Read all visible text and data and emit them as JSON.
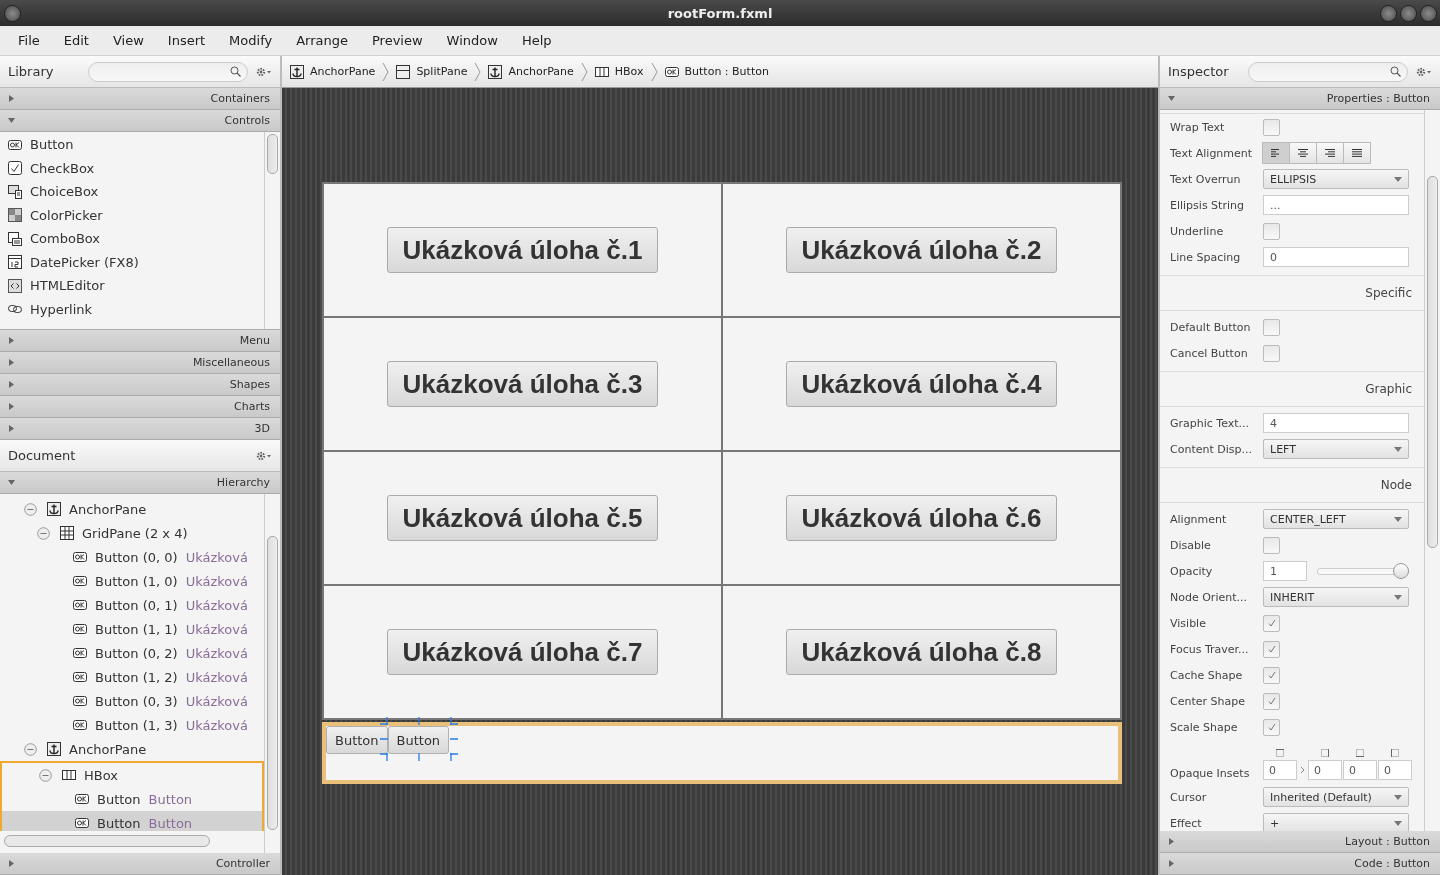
{
  "window": {
    "title": "rootForm.fxml"
  },
  "menu": [
    "File",
    "Edit",
    "View",
    "Insert",
    "Modify",
    "Arrange",
    "Preview",
    "Window",
    "Help"
  ],
  "library": {
    "title": "Library",
    "sections_before": [
      {
        "label": "Containers",
        "expanded": false
      },
      {
        "label": "Controls",
        "expanded": true
      }
    ],
    "items": [
      {
        "label": "Button",
        "kind": "ok"
      },
      {
        "label": "CheckBox",
        "kind": "check"
      },
      {
        "label": "ChoiceBox",
        "kind": "choice"
      },
      {
        "label": "ColorPicker",
        "kind": "color"
      },
      {
        "label": "ComboBox",
        "kind": "combo"
      },
      {
        "label": "DatePicker  (FX8)",
        "kind": "date"
      },
      {
        "label": "HTMLEditor",
        "kind": "html"
      },
      {
        "label": "Hyperlink",
        "kind": "link"
      }
    ],
    "sections_after": [
      {
        "label": "Menu",
        "expanded": false
      },
      {
        "label": "Miscellaneous",
        "expanded": false
      },
      {
        "label": "Shapes",
        "expanded": false
      },
      {
        "label": "Charts",
        "expanded": false
      },
      {
        "label": "3D",
        "expanded": false
      }
    ]
  },
  "document": {
    "title": "Document",
    "section": {
      "label": "Hierarchy",
      "expanded": true
    },
    "tree": [
      {
        "label": "AnchorPane",
        "kind": "anchor",
        "expanded": true,
        "selected": false,
        "children": [
          {
            "label": "GridPane (2 x 4)",
            "kind": "grid",
            "expanded": true,
            "selected": false,
            "children": [
              {
                "label": "Button (0, 0)",
                "info": "Ukázková",
                "kind": "ok",
                "selected": false
              },
              {
                "label": "Button (1, 0)",
                "info": "Ukázková",
                "kind": "ok",
                "selected": false
              },
              {
                "label": "Button (0, 1)",
                "info": "Ukázková",
                "kind": "ok",
                "selected": false
              },
              {
                "label": "Button (1, 1)",
                "info": "Ukázková",
                "kind": "ok",
                "selected": false
              },
              {
                "label": "Button (0, 2)",
                "info": "Ukázková",
                "kind": "ok",
                "selected": false
              },
              {
                "label": "Button (1, 2)",
                "info": "Ukázková",
                "kind": "ok",
                "selected": false
              },
              {
                "label": "Button (0, 3)",
                "info": "Ukázková",
                "kind": "ok",
                "selected": false
              },
              {
                "label": "Button (1, 3)",
                "info": "Ukázková",
                "kind": "ok",
                "selected": false
              }
            ]
          }
        ]
      },
      {
        "label": "AnchorPane",
        "kind": "anchor",
        "expanded": true,
        "selected": false,
        "children": [
          {
            "label": "HBox",
            "kind": "hbox",
            "expanded": true,
            "selected": false,
            "outlined": true,
            "children": [
              {
                "label": "Button",
                "info": "Button",
                "kind": "ok",
                "selected": false
              },
              {
                "label": "Button",
                "info": "Button",
                "kind": "ok",
                "selected": true
              }
            ]
          }
        ]
      }
    ],
    "footer": {
      "label": "Controller",
      "expanded": false
    }
  },
  "breadcrumb": [
    {
      "label": "AnchorPane",
      "kind": "anchor"
    },
    {
      "label": "SplitPane",
      "kind": "split"
    },
    {
      "label": "AnchorPane",
      "kind": "anchor"
    },
    {
      "label": "HBox",
      "kind": "hbox"
    },
    {
      "label": "Button : Button",
      "kind": "ok"
    }
  ],
  "canvas": {
    "grid_buttons": [
      "Ukázková úloha č.1",
      "Ukázková úloha č.2",
      "Ukázková úloha č.3",
      "Ukázková úloha č.4",
      "Ukázková úloha č.5",
      "Ukázková úloha č.6",
      "Ukázková úloha č.7",
      "Ukázková úloha č.8"
    ],
    "hbox_buttons": [
      {
        "label": "Button",
        "selected": false
      },
      {
        "label": "Button",
        "selected": true
      }
    ]
  },
  "inspector": {
    "title": "Inspector",
    "header": {
      "label": "Properties : Button",
      "expanded": true
    },
    "rows": [
      {
        "kind": "checkbox",
        "label": "Wrap Text",
        "checked": false
      },
      {
        "kind": "alignment",
        "label": "Text Alignment",
        "options": [
          {
            "kind": "left",
            "selected": true
          },
          {
            "kind": "center",
            "selected": false
          },
          {
            "kind": "right",
            "selected": false
          },
          {
            "kind": "justify",
            "selected": false
          }
        ]
      },
      {
        "kind": "dropdown",
        "label": "Text Overrun",
        "value": "ELLIPSIS"
      },
      {
        "kind": "text",
        "label": "Ellipsis String",
        "value": "..."
      },
      {
        "kind": "checkbox",
        "label": "Underline",
        "checked": false
      },
      {
        "kind": "text",
        "label": "Line Spacing",
        "value": "0"
      },
      {
        "kind": "heading",
        "label": "Specific"
      },
      {
        "kind": "checkbox",
        "label": "Default Button",
        "checked": false
      },
      {
        "kind": "checkbox",
        "label": "Cancel Button",
        "checked": false
      },
      {
        "kind": "heading",
        "label": "Graphic"
      },
      {
        "kind": "text",
        "label": "Graphic Text...",
        "value": "4"
      },
      {
        "kind": "dropdown",
        "label": "Content Disp...",
        "value": "LEFT"
      },
      {
        "kind": "heading",
        "label": "Node"
      },
      {
        "kind": "dropdown",
        "label": "Alignment",
        "value": "CENTER_LEFT"
      },
      {
        "kind": "checkbox",
        "label": "Disable",
        "checked": false
      },
      {
        "kind": "slider",
        "label": "Opacity",
        "value": "1",
        "level": 1
      },
      {
        "kind": "dropdown",
        "label": "Node Orient...",
        "value": "INHERIT"
      },
      {
        "kind": "checkbox",
        "label": "Visible",
        "checked": true
      },
      {
        "kind": "checkbox",
        "label": "Focus Traver...",
        "checked": true
      },
      {
        "kind": "checkbox",
        "label": "Cache Shape",
        "checked": true
      },
      {
        "kind": "checkbox",
        "label": "Center Shape",
        "checked": true
      },
      {
        "kind": "checkbox",
        "label": "Scale Shape",
        "checked": true
      },
      {
        "kind": "insets",
        "label": "Opaque Insets",
        "values": [
          "0",
          "0",
          "0",
          "0"
        ]
      },
      {
        "kind": "dropdown",
        "label": "Cursor",
        "value": "Inherited (Default)"
      },
      {
        "kind": "dropdown",
        "label": "Effect",
        "value": "+"
      }
    ],
    "footers": [
      {
        "label": "Layout : Button",
        "expanded": false
      },
      {
        "label": "Code : Button",
        "expanded": false
      }
    ]
  }
}
